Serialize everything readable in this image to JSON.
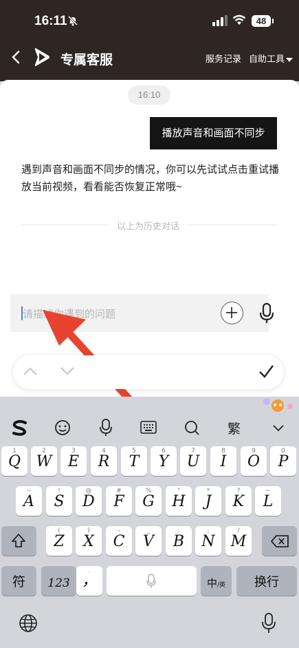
{
  "status_bar": {
    "time": "16:11",
    "battery": "48"
  },
  "header": {
    "title": "专属客服",
    "service_records": "服务记录",
    "self_tools": "自助工具"
  },
  "chat": {
    "timestamp": "16:10",
    "user_message": "播放声音和画面不同步",
    "bot_message": "遇到声音和画面不同步的情况，你可以先试试点击重试播放当前视频，看看能否恢复正常哦~",
    "history_divider": "以上为历史对话"
  },
  "input": {
    "placeholder": "请描述你遇到的问题"
  },
  "keyboard": {
    "toolbar_traditional": "繁",
    "row1": [
      "Q",
      "W",
      "E",
      "R",
      "T",
      "Y",
      "U",
      "I",
      "O",
      "P"
    ],
    "row1_sub": [
      "1",
      "2",
      "3",
      "4",
      "5",
      "6",
      "7",
      "8",
      "9",
      "0"
    ],
    "row2": [
      "A",
      "S",
      "D",
      "F",
      "G",
      "H",
      "J",
      "K",
      "L"
    ],
    "row2_sub": [
      "~",
      "!",
      "@",
      "#",
      "%",
      "\"",
      "*",
      "?",
      "~"
    ],
    "row3": [
      "Z",
      "X",
      "C",
      "V",
      "B",
      "N",
      "M"
    ],
    "row3_sub": [
      "(",
      ")",
      "-",
      "_",
      ":",
      ";",
      "/"
    ],
    "symbols_key": "符",
    "numbers_key": "123",
    "comma_key": "，",
    "lang_key": "中",
    "lang_key_sub": "/英",
    "return_key": "换行"
  }
}
